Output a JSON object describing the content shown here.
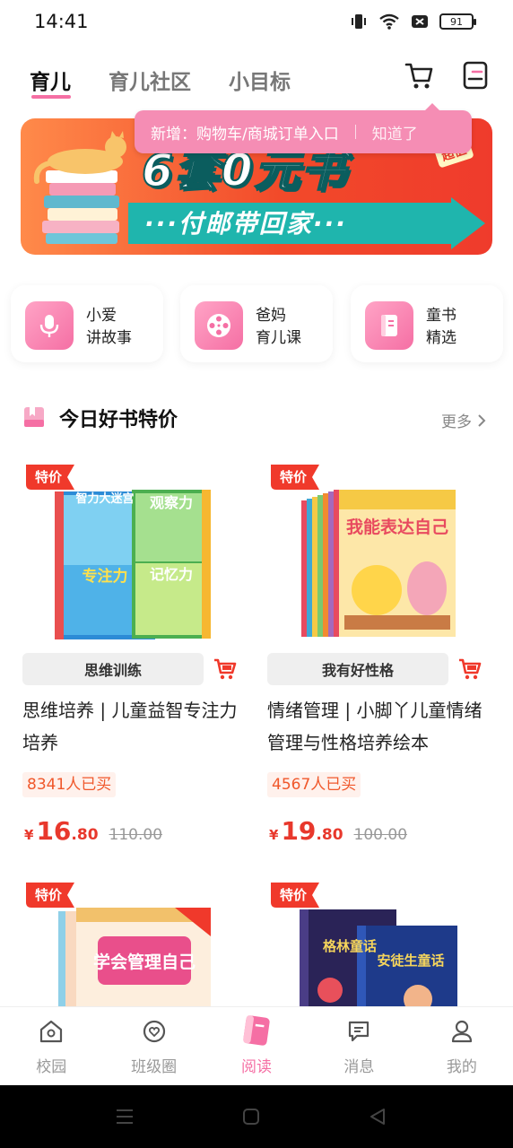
{
  "status": {
    "time": "14:41",
    "battery": "91"
  },
  "top_tabs": [
    {
      "label": "育儿",
      "active": true
    },
    {
      "label": "育儿社区",
      "active": false
    },
    {
      "label": "小目标",
      "active": false
    }
  ],
  "tooltip": {
    "text": "新增：购物车/商城订单入口",
    "dismiss": "知道了"
  },
  "banner": {
    "title": "6套0元书",
    "subtitle": "···付邮带回家···",
    "badge": "超值"
  },
  "quick_entries": [
    {
      "line1": "小爱",
      "line2": "讲故事",
      "icon": "microphone-icon"
    },
    {
      "line1": "爸妈",
      "line2": "育儿课",
      "icon": "film-reel-icon"
    },
    {
      "line1": "童书",
      "line2": "精选",
      "icon": "book-icon"
    }
  ],
  "section": {
    "title": "今日好书特价",
    "more": "更多"
  },
  "products": [
    {
      "sale_tag": "特价",
      "category": "思维训练",
      "title": "思维培养 | 儿童益智专注力培养",
      "sold": "8341人已买",
      "currency": "¥",
      "price_int": "16",
      "price_dec": ".80",
      "price_old": "110.00",
      "cover_texts": [
        "智力大迷宫",
        "观察力",
        "专注力",
        "记忆力"
      ]
    },
    {
      "sale_tag": "特价",
      "category": "我有好性格",
      "title": "情绪管理 | 小脚丫儿童情绪管理与性格培养绘本",
      "sold": "4567人已买",
      "currency": "¥",
      "price_int": "19",
      "price_dec": ".80",
      "price_old": "100.00",
      "cover_texts": [
        "我能表达自己"
      ]
    },
    {
      "sale_tag": "特价",
      "cover_texts": [
        "学会管理自己"
      ]
    },
    {
      "sale_tag": "特价",
      "cover_texts": [
        "格林童话",
        "安徒生童话"
      ]
    }
  ],
  "bottom_nav": [
    {
      "label": "校园",
      "icon": "school-icon",
      "active": false
    },
    {
      "label": "班级圈",
      "icon": "heart-chat-icon",
      "active": false
    },
    {
      "label": "阅读",
      "icon": "reading-book-icon",
      "active": true
    },
    {
      "label": "消息",
      "icon": "message-icon",
      "active": false
    },
    {
      "label": "我的",
      "icon": "profile-icon",
      "active": false
    }
  ],
  "colors": {
    "accent": "#f56fa4",
    "price": "#e8382c",
    "banner": "#f24a2a",
    "tooltip": "#f58db4"
  }
}
